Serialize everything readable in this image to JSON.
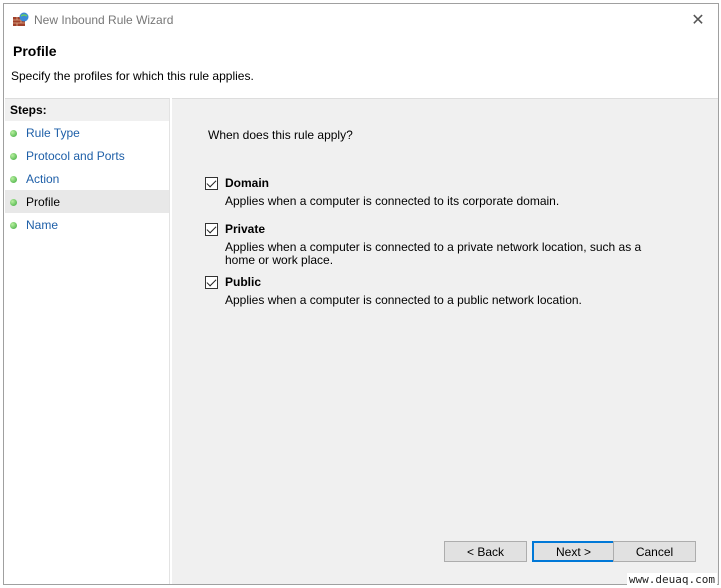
{
  "window": {
    "title": "New Inbound Rule Wizard",
    "close_icon": "close-icon"
  },
  "header": {
    "title": "Profile",
    "subtitle": "Specify the profiles for which this rule applies."
  },
  "steps": {
    "heading": "Steps:",
    "items": [
      {
        "label": "Rule Type"
      },
      {
        "label": "Protocol and Ports"
      },
      {
        "label": "Action"
      },
      {
        "label": "Profile",
        "current": true
      },
      {
        "label": "Name"
      }
    ]
  },
  "main": {
    "question": "When does this rule apply?",
    "options": [
      {
        "label": "Domain",
        "checked": true,
        "description": "Applies when a computer is connected to its corporate domain."
      },
      {
        "label": "Private",
        "checked": true,
        "description": "Applies when a computer is connected to a private network location, such as a home or work place."
      },
      {
        "label": "Public",
        "checked": true,
        "description": "Applies when a computer is connected to a public network location."
      }
    ]
  },
  "buttons": {
    "back": "< Back",
    "next": "Next >",
    "cancel": "Cancel"
  },
  "watermark": "www.deuaq.com"
}
